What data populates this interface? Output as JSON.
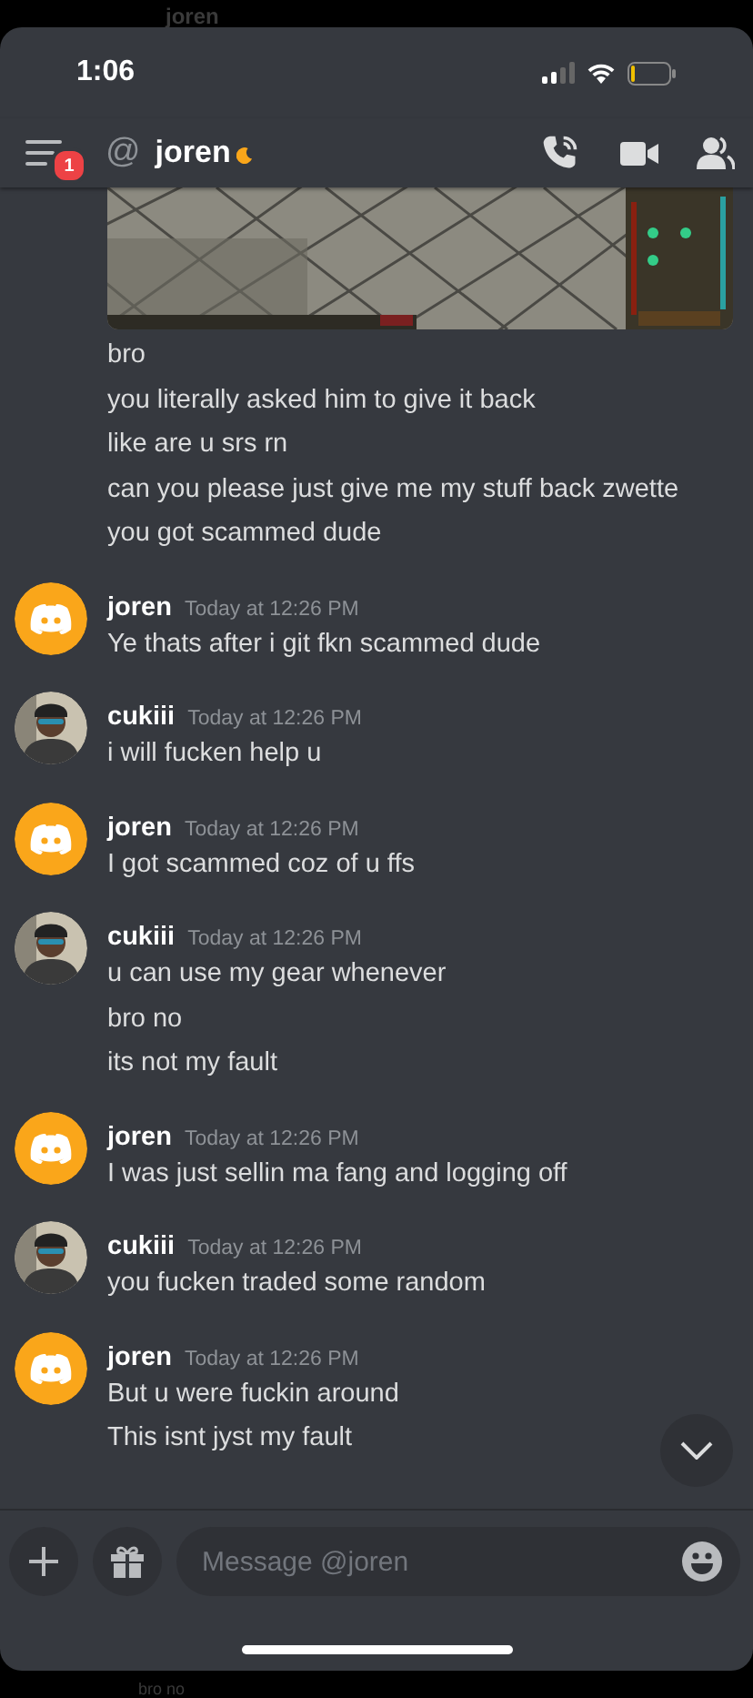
{
  "backdrop": {
    "title": "joren",
    "message": "bro no"
  },
  "status_bar": {
    "time": "1:06"
  },
  "header": {
    "unread_badge": "1",
    "at": "@",
    "title": "joren"
  },
  "loose_lines": [
    "bro",
    "you literally asked him to give it back",
    "like are u srs rn",
    "can you please just give me my stuff back zwette",
    "you got scammed dude"
  ],
  "groups": [
    {
      "author": "joren",
      "kind": "logo",
      "time": "Today at 12:26 PM",
      "lines": [
        "Ye thats after i git fkn scammed dude"
      ]
    },
    {
      "author": "cukiii",
      "time": "Today at 12:26 PM",
      "lines": [
        "i will fucken help u"
      ]
    },
    {
      "author": "joren",
      "kind": "logo",
      "time": "Today at 12:26 PM",
      "lines": [
        "I got scammed coz of u ffs"
      ]
    },
    {
      "author": "cukiii",
      "time": "Today at 12:26 PM",
      "lines": [
        "u can use my gear whenever",
        "bro no",
        "its not my fault"
      ]
    },
    {
      "author": "joren",
      "kind": "logo",
      "time": "Today at 12:26 PM",
      "lines": [
        "I was just sellin ma fang and logging off"
      ]
    },
    {
      "author": "cukiii",
      "time": "Today at 12:26 PM",
      "lines": [
        "you fucken traded some random"
      ]
    },
    {
      "author": "joren",
      "kind": "logo",
      "time": "Today at 12:26 PM",
      "lines": [
        "But u were fuckin around",
        "This isnt jyst my fault"
      ]
    }
  ],
  "composer": {
    "placeholder": "Message @joren"
  }
}
